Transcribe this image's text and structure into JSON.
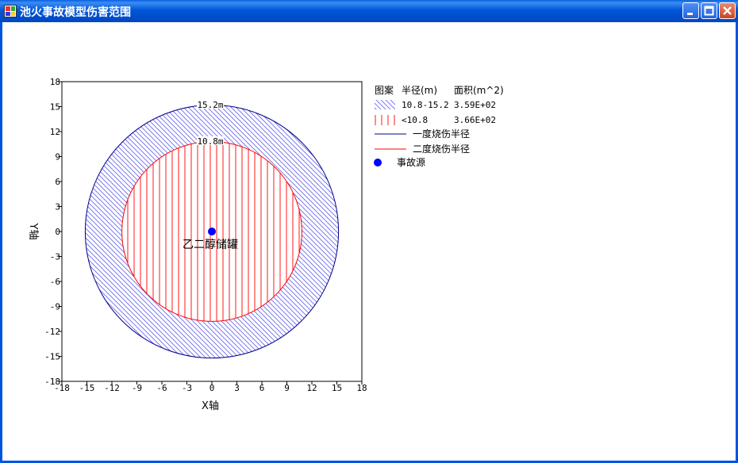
{
  "window": {
    "title": "池火事故模型伤害范围",
    "buttons": [
      "minimize",
      "maximize",
      "close"
    ]
  },
  "plot": {
    "xlabel": "X轴",
    "ylabel": "Y轴",
    "ticks": [
      "-18",
      "-15",
      "-12",
      "-9",
      "-6",
      "-3",
      "0",
      "3",
      "6",
      "9",
      "12",
      "15",
      "18"
    ],
    "source_label": "乙二醇储罐",
    "outer_ring_label": "15.2m",
    "inner_ring_label": "10.8m"
  },
  "legend": {
    "header_pattern": "图案",
    "header_radius": "半径(m)",
    "header_area": "面积(m^2)",
    "rows": [
      {
        "radius": "10.8-15.2",
        "area": "3.59E+02"
      },
      {
        "radius": "<10.8",
        "area": "3.66E+02"
      }
    ],
    "line_first": "一度烧伤半径",
    "line_second": "二度烧伤半径",
    "source": "事故源"
  },
  "colors": {
    "first_degree": "#00008b",
    "second_degree": "#ff0000",
    "hatch": "#6a6af0",
    "source_dot": "#0000ff"
  },
  "chart_data": {
    "type": "scatter",
    "xlim": [
      -18,
      18
    ],
    "ylim": [
      -18,
      18
    ],
    "circles": [
      {
        "name": "一度烧伤半径",
        "radius": 15.2,
        "area": "3.59E+02"
      },
      {
        "name": "二度烧伤半径",
        "radius": 10.8,
        "area": "3.66E+02"
      }
    ],
    "points": [
      {
        "x": 0,
        "y": 0,
        "label": "乙二醇储罐"
      }
    ]
  }
}
